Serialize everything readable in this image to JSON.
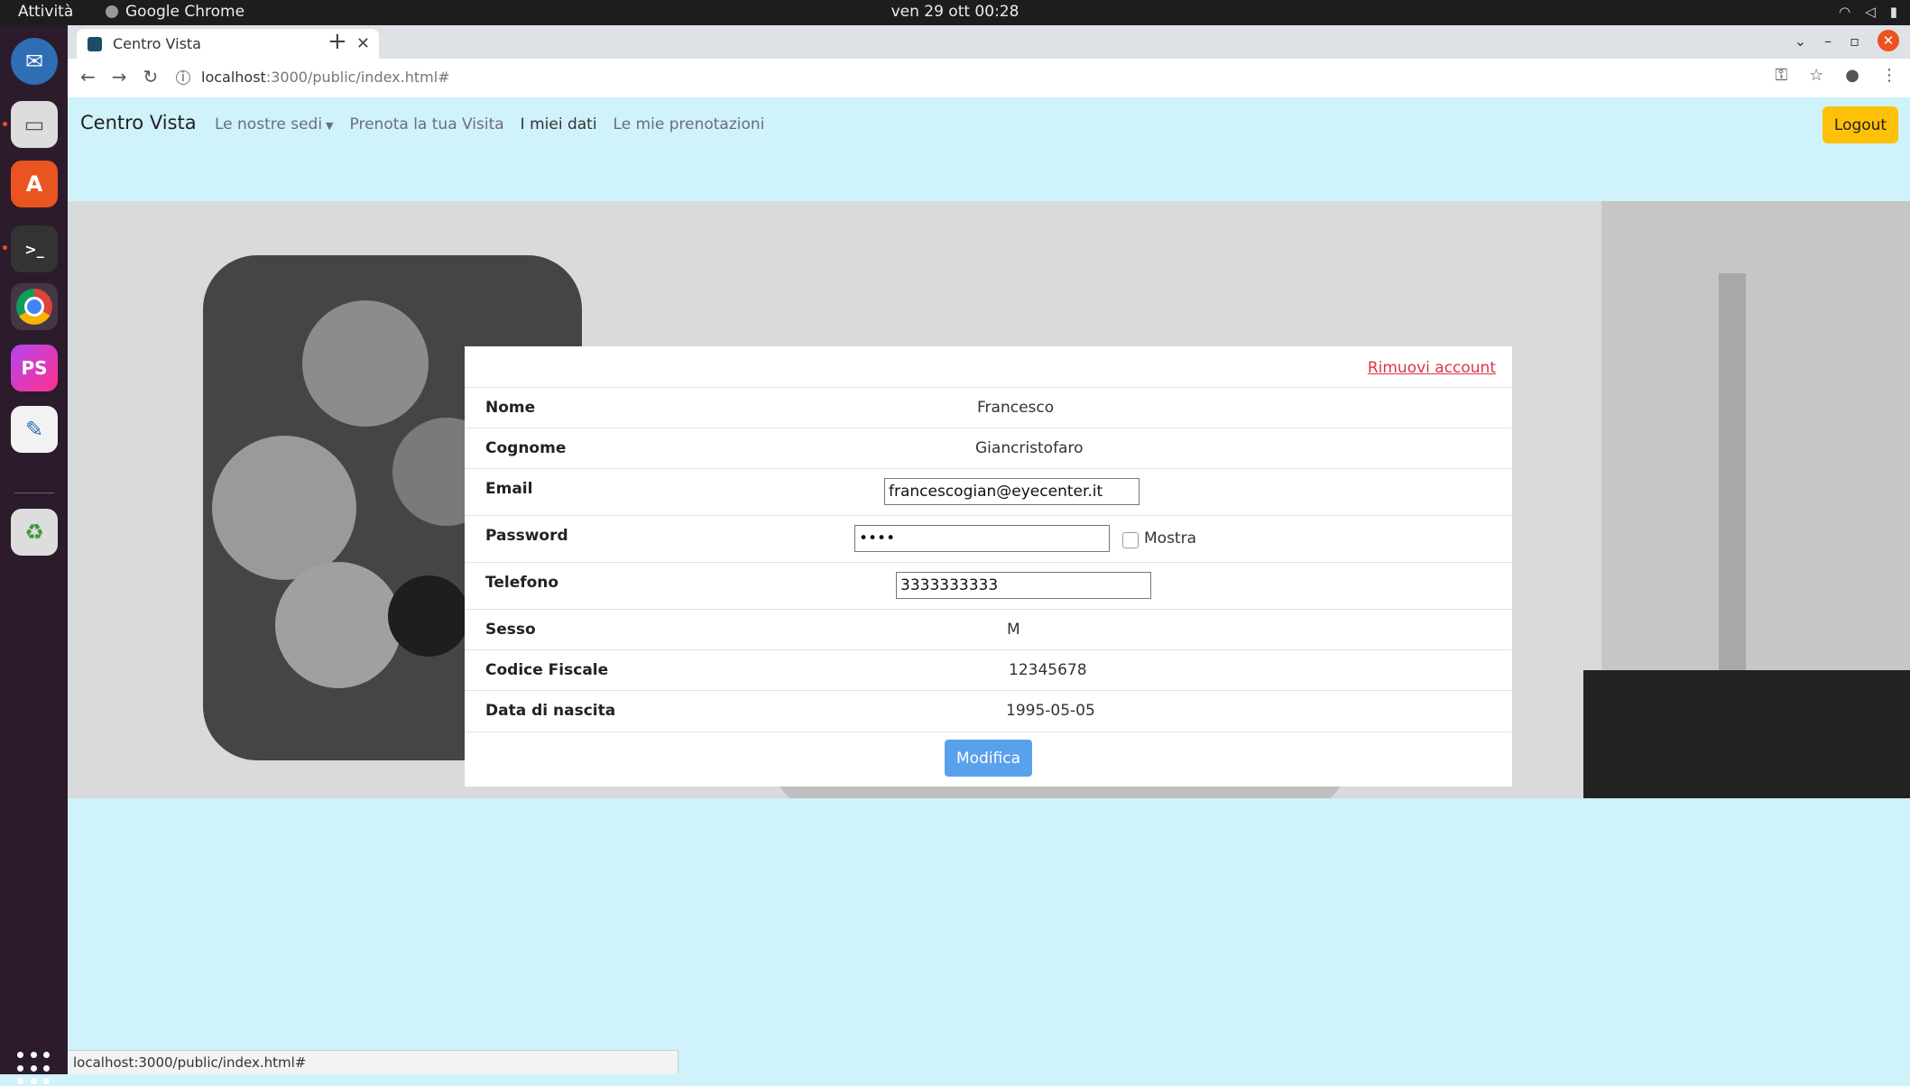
{
  "os": {
    "activities_label": "Attività",
    "app_name": "Google Chrome",
    "clock": "ven 29 ott  00:28"
  },
  "browser": {
    "tab_title": "Centro Vista",
    "url_host": "localhost",
    "url_path": ":3000/public/index.html#",
    "status_url": "localhost:3000/public/index.html#"
  },
  "site": {
    "brand": "Centro Vista",
    "nav": {
      "sedi": "Le nostre sedi",
      "prenota": "Prenota la tua Visita",
      "dati": "I miei dati",
      "prenotazioni": "Le mie prenotazioni"
    },
    "logout_label": "Logout"
  },
  "profile": {
    "remove_account": "Rimuovi account",
    "nome_label": "Nome",
    "nome": "Francesco",
    "cognome_label": "Cognome",
    "cognome": "Giancristofaro",
    "email_label": "Email",
    "email": "francescogian@eyecenter.it",
    "password_label": "Password",
    "password": "••••",
    "show_label": "Mostra",
    "telefono_label": "Telefono",
    "telefono": "3333333333",
    "sesso_label": "Sesso",
    "sesso": "M",
    "cf_label": "Codice Fiscale",
    "cf": "12345678",
    "nascita_label": "Data di nascita",
    "nascita": "1995-05-05",
    "edit_label": "Modifica"
  },
  "colors": {
    "page_bg": "#cff2fb",
    "logout_bg": "#ffc107",
    "edit_bg": "#5aa1ec",
    "remove_link": "#dc3545"
  }
}
